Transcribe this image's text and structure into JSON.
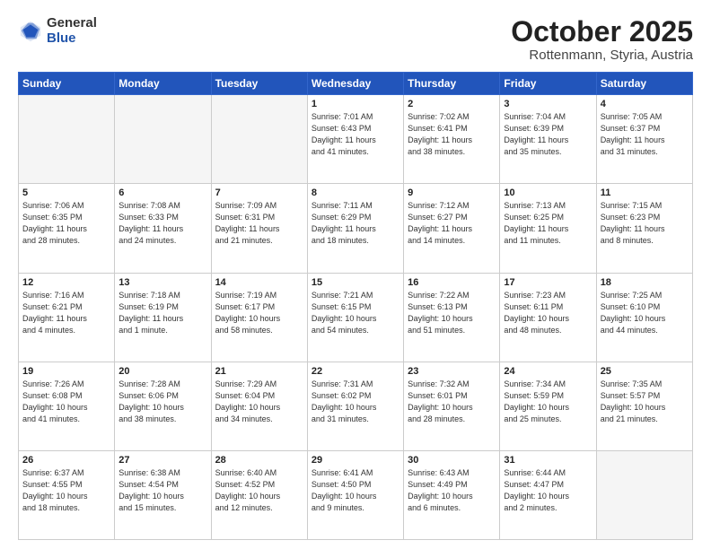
{
  "header": {
    "logo_general": "General",
    "logo_blue": "Blue",
    "month_title": "October 2025",
    "subtitle": "Rottenmann, Styria, Austria"
  },
  "weekdays": [
    "Sunday",
    "Monday",
    "Tuesday",
    "Wednesday",
    "Thursday",
    "Friday",
    "Saturday"
  ],
  "weeks": [
    [
      {
        "day": "",
        "info": ""
      },
      {
        "day": "",
        "info": ""
      },
      {
        "day": "",
        "info": ""
      },
      {
        "day": "1",
        "info": "Sunrise: 7:01 AM\nSunset: 6:43 PM\nDaylight: 11 hours\nand 41 minutes."
      },
      {
        "day": "2",
        "info": "Sunrise: 7:02 AM\nSunset: 6:41 PM\nDaylight: 11 hours\nand 38 minutes."
      },
      {
        "day": "3",
        "info": "Sunrise: 7:04 AM\nSunset: 6:39 PM\nDaylight: 11 hours\nand 35 minutes."
      },
      {
        "day": "4",
        "info": "Sunrise: 7:05 AM\nSunset: 6:37 PM\nDaylight: 11 hours\nand 31 minutes."
      }
    ],
    [
      {
        "day": "5",
        "info": "Sunrise: 7:06 AM\nSunset: 6:35 PM\nDaylight: 11 hours\nand 28 minutes."
      },
      {
        "day": "6",
        "info": "Sunrise: 7:08 AM\nSunset: 6:33 PM\nDaylight: 11 hours\nand 24 minutes."
      },
      {
        "day": "7",
        "info": "Sunrise: 7:09 AM\nSunset: 6:31 PM\nDaylight: 11 hours\nand 21 minutes."
      },
      {
        "day": "8",
        "info": "Sunrise: 7:11 AM\nSunset: 6:29 PM\nDaylight: 11 hours\nand 18 minutes."
      },
      {
        "day": "9",
        "info": "Sunrise: 7:12 AM\nSunset: 6:27 PM\nDaylight: 11 hours\nand 14 minutes."
      },
      {
        "day": "10",
        "info": "Sunrise: 7:13 AM\nSunset: 6:25 PM\nDaylight: 11 hours\nand 11 minutes."
      },
      {
        "day": "11",
        "info": "Sunrise: 7:15 AM\nSunset: 6:23 PM\nDaylight: 11 hours\nand 8 minutes."
      }
    ],
    [
      {
        "day": "12",
        "info": "Sunrise: 7:16 AM\nSunset: 6:21 PM\nDaylight: 11 hours\nand 4 minutes."
      },
      {
        "day": "13",
        "info": "Sunrise: 7:18 AM\nSunset: 6:19 PM\nDaylight: 11 hours\nand 1 minute."
      },
      {
        "day": "14",
        "info": "Sunrise: 7:19 AM\nSunset: 6:17 PM\nDaylight: 10 hours\nand 58 minutes."
      },
      {
        "day": "15",
        "info": "Sunrise: 7:21 AM\nSunset: 6:15 PM\nDaylight: 10 hours\nand 54 minutes."
      },
      {
        "day": "16",
        "info": "Sunrise: 7:22 AM\nSunset: 6:13 PM\nDaylight: 10 hours\nand 51 minutes."
      },
      {
        "day": "17",
        "info": "Sunrise: 7:23 AM\nSunset: 6:11 PM\nDaylight: 10 hours\nand 48 minutes."
      },
      {
        "day": "18",
        "info": "Sunrise: 7:25 AM\nSunset: 6:10 PM\nDaylight: 10 hours\nand 44 minutes."
      }
    ],
    [
      {
        "day": "19",
        "info": "Sunrise: 7:26 AM\nSunset: 6:08 PM\nDaylight: 10 hours\nand 41 minutes."
      },
      {
        "day": "20",
        "info": "Sunrise: 7:28 AM\nSunset: 6:06 PM\nDaylight: 10 hours\nand 38 minutes."
      },
      {
        "day": "21",
        "info": "Sunrise: 7:29 AM\nSunset: 6:04 PM\nDaylight: 10 hours\nand 34 minutes."
      },
      {
        "day": "22",
        "info": "Sunrise: 7:31 AM\nSunset: 6:02 PM\nDaylight: 10 hours\nand 31 minutes."
      },
      {
        "day": "23",
        "info": "Sunrise: 7:32 AM\nSunset: 6:01 PM\nDaylight: 10 hours\nand 28 minutes."
      },
      {
        "day": "24",
        "info": "Sunrise: 7:34 AM\nSunset: 5:59 PM\nDaylight: 10 hours\nand 25 minutes."
      },
      {
        "day": "25",
        "info": "Sunrise: 7:35 AM\nSunset: 5:57 PM\nDaylight: 10 hours\nand 21 minutes."
      }
    ],
    [
      {
        "day": "26",
        "info": "Sunrise: 6:37 AM\nSunset: 4:55 PM\nDaylight: 10 hours\nand 18 minutes."
      },
      {
        "day": "27",
        "info": "Sunrise: 6:38 AM\nSunset: 4:54 PM\nDaylight: 10 hours\nand 15 minutes."
      },
      {
        "day": "28",
        "info": "Sunrise: 6:40 AM\nSunset: 4:52 PM\nDaylight: 10 hours\nand 12 minutes."
      },
      {
        "day": "29",
        "info": "Sunrise: 6:41 AM\nSunset: 4:50 PM\nDaylight: 10 hours\nand 9 minutes."
      },
      {
        "day": "30",
        "info": "Sunrise: 6:43 AM\nSunset: 4:49 PM\nDaylight: 10 hours\nand 6 minutes."
      },
      {
        "day": "31",
        "info": "Sunrise: 6:44 AM\nSunset: 4:47 PM\nDaylight: 10 hours\nand 2 minutes."
      },
      {
        "day": "",
        "info": ""
      }
    ]
  ]
}
